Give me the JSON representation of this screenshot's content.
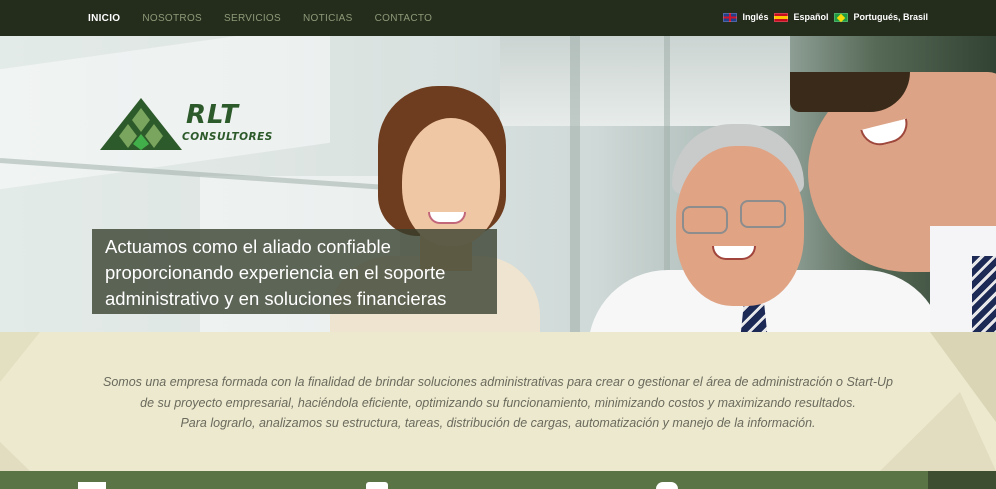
{
  "nav": {
    "items": [
      {
        "label": "INICIO",
        "active": true
      },
      {
        "label": "NOSOTROS",
        "active": false
      },
      {
        "label": "SERVICIOS",
        "active": false
      },
      {
        "label": "NOTICIAS",
        "active": false
      },
      {
        "label": "CONTACTO",
        "active": false
      }
    ],
    "languages": [
      {
        "label": "Inglés",
        "flag": "uk-flag-icon"
      },
      {
        "label": "Español",
        "flag": "spain-flag-icon"
      },
      {
        "label": "Portugués, Brasil",
        "flag": "brazil-flag-icon"
      }
    ]
  },
  "logo": {
    "name": "RLT",
    "subtitle": "CONSULTORES"
  },
  "hero": {
    "tagline": [
      "Actuamos como el aliado confiable",
      "proporcionando experiencia en el soporte",
      "administrativo y en soluciones financieras"
    ]
  },
  "intro": {
    "lines": [
      "Somos una empresa formada con la finalidad de brindar soluciones administrativas para crear o gestionar el área de administración o Start-Up",
      "de su proyecto empresarial, haciéndola eficiente, optimizando su funcionamiento, minimizando costos y maximizando resultados.",
      "Para lograrlo, analizamos su estructura, tareas, distribución de cargas, automatización y manejo de la información."
    ]
  },
  "colors": {
    "nav_bg": "#242c1c",
    "brand_green": "#2d5a2a",
    "intro_bg": "#ede9cf",
    "bar_green": "#5a7446"
  }
}
